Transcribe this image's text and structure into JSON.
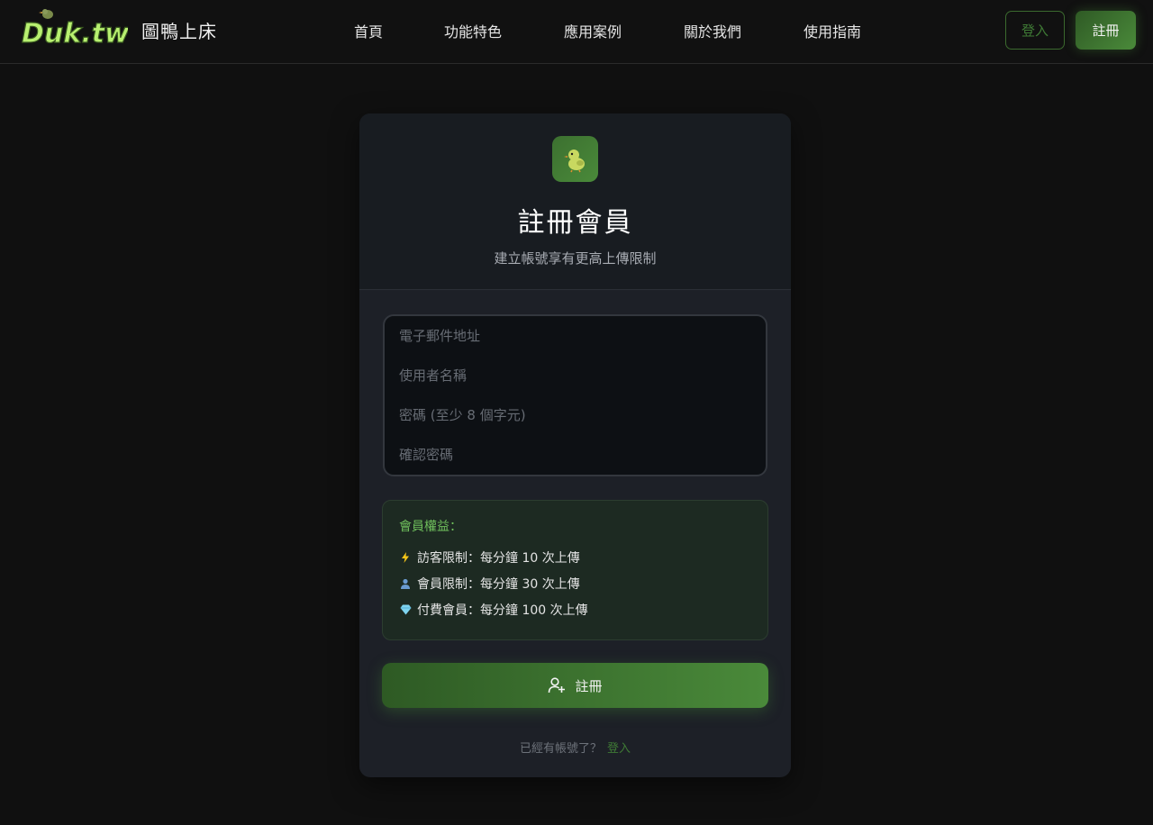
{
  "header": {
    "logo_text": "Duk.tw",
    "site_name": "圖鴨上床",
    "nav": [
      {
        "label": "首頁"
      },
      {
        "label": "功能特色"
      },
      {
        "label": "應用案例"
      },
      {
        "label": "關於我們"
      },
      {
        "label": "使用指南"
      }
    ],
    "login_label": "登入",
    "register_label": "註冊"
  },
  "card": {
    "icon": "duck-icon",
    "title": "註冊會員",
    "subtitle": "建立帳號享有更高上傳限制",
    "form": {
      "email_placeholder": "電子郵件地址",
      "username_placeholder": "使用者名稱",
      "password_placeholder": "密碼 (至少 8 個字元)",
      "confirm_placeholder": "確認密碼"
    },
    "benefits": {
      "title": "會員權益：",
      "items": [
        {
          "icon": "lightning-icon",
          "label": "訪客限制",
          "value": "：每分鐘 10 次上傳"
        },
        {
          "icon": "user-icon",
          "label": "會員限制",
          "value": "：每分鐘 30 次上傳"
        },
        {
          "icon": "diamond-icon",
          "label": "付費會員",
          "value": "：每分鐘 100 次上傳"
        }
      ]
    },
    "submit_label": "註冊",
    "footer_text": "已經有帳號了？",
    "footer_link": "登入"
  },
  "colors": {
    "background": "#101010",
    "accent_green": "#4a8a3a",
    "benefits_title": "#6fbf5c",
    "logo_green": "#b8f070"
  }
}
